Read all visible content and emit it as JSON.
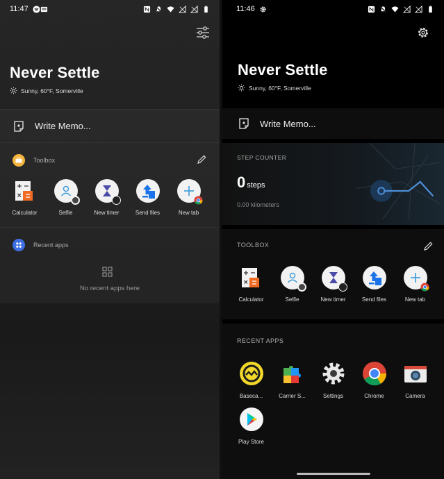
{
  "colors": {
    "bg_left": "#242424",
    "bg_right": "#000000",
    "toolbox_badge": "#f4b63f",
    "recent_badge": "#3d6fe0",
    "step_accent": "#4d8fd6"
  },
  "left": {
    "status": {
      "time": "11:47",
      "icons": [
        "spotify-icon",
        "mail-icon",
        "nfc-icon",
        "mute-icon",
        "wifi-icon",
        "signal-icon",
        "signal-icon",
        "battery-icon"
      ]
    },
    "header": {
      "title": "Never Settle",
      "weather": "Sunny, 60°F, Somerville",
      "settings_icon": "sliders-icon"
    },
    "memo": {
      "label": "Write Memo..."
    },
    "toolbox": {
      "title": "Toolbox",
      "items": [
        {
          "label": "Calculator",
          "icon": "calculator-icon"
        },
        {
          "label": "Selfie",
          "icon": "selfie-icon"
        },
        {
          "label": "New timer",
          "icon": "timer-icon"
        },
        {
          "label": "Send files",
          "icon": "send-files-icon"
        },
        {
          "label": "New tab",
          "icon": "new-tab-icon"
        }
      ]
    },
    "recent": {
      "title": "Recent apps",
      "empty_text": "No recent apps here"
    }
  },
  "right": {
    "status": {
      "time": "11:46",
      "icons": [
        "gear-icon",
        "nfc-icon",
        "mute-icon",
        "wifi-icon",
        "signal-icon",
        "signal-icon",
        "battery-icon"
      ]
    },
    "header": {
      "title": "Never Settle",
      "weather": "Sunny, 60°F, Somerville",
      "settings_icon": "gear-icon"
    },
    "memo": {
      "label": "Write Memo..."
    },
    "step_counter": {
      "title": "STEP COUNTER",
      "steps": "0",
      "steps_unit": "steps",
      "distance": "0.00 kilometers"
    },
    "toolbox": {
      "title": "TOOLBOX",
      "items": [
        {
          "label": "Calculator",
          "icon": "calculator-icon"
        },
        {
          "label": "Selfie",
          "icon": "selfie-icon"
        },
        {
          "label": "New timer",
          "icon": "timer-icon"
        },
        {
          "label": "Send files",
          "icon": "send-files-icon"
        },
        {
          "label": "New tab",
          "icon": "new-tab-icon"
        }
      ]
    },
    "recent": {
      "title": "RECENT APPS",
      "apps": [
        {
          "label": "Baseca...",
          "icon": "basecamp-icon"
        },
        {
          "label": "Carrier S...",
          "icon": "carrier-services-icon"
        },
        {
          "label": "Settings",
          "icon": "settings-icon"
        },
        {
          "label": "Chrome",
          "icon": "chrome-icon"
        },
        {
          "label": "Camera",
          "icon": "camera-icon"
        },
        {
          "label": "Play Store",
          "icon": "play-store-icon"
        }
      ]
    }
  }
}
